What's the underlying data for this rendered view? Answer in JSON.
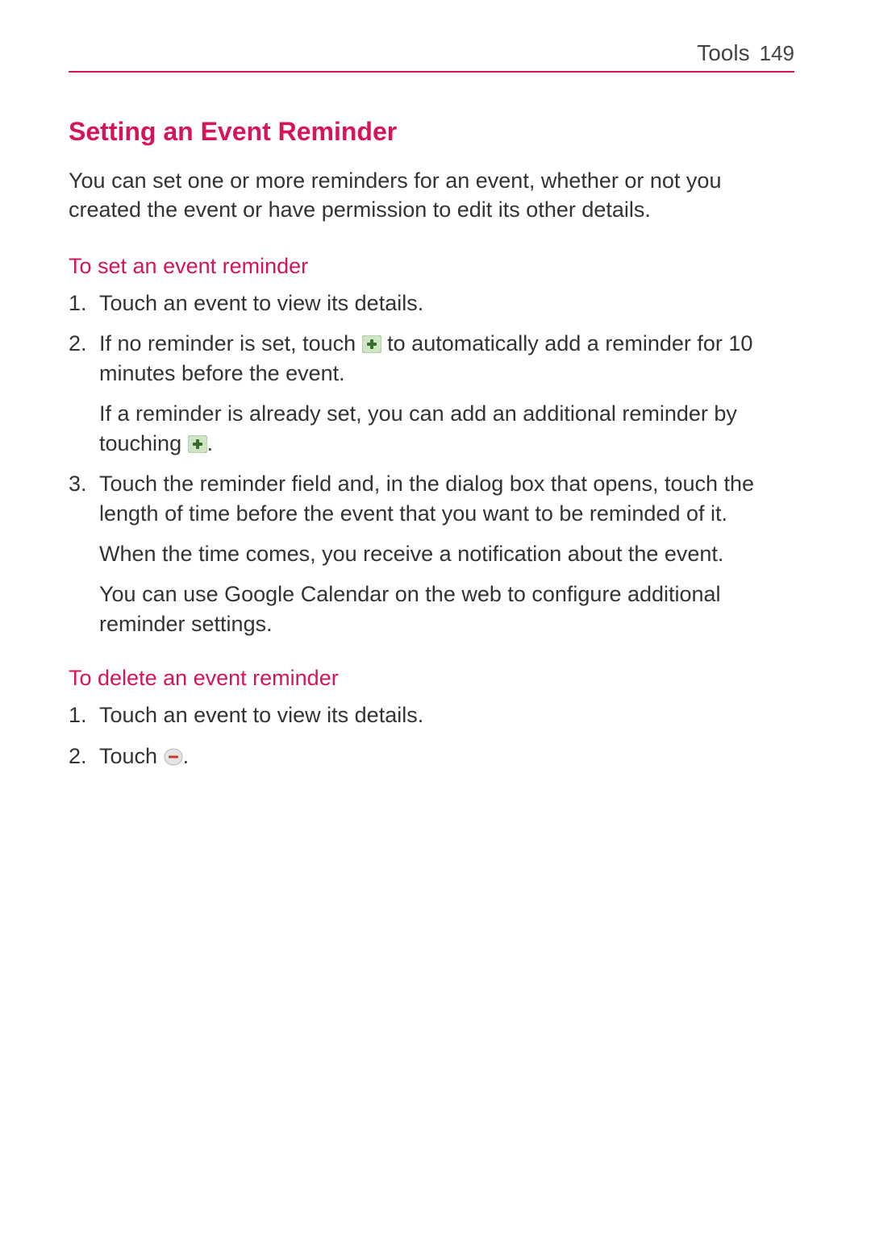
{
  "header": {
    "section": "Tools",
    "page": "149"
  },
  "mainHeading": "Setting an Event Reminder",
  "intro": "You can set one or more reminders for an event, whether or not you created the event or have permission to edit its other details.",
  "section1": {
    "heading": "To set an event reminder",
    "items": {
      "n1": "1.",
      "t1": "Touch an event to view its details.",
      "n2": "2.",
      "t2a": "If no reminder is set, touch ",
      "t2b": " to automatically add a reminder for 10 minutes before the event.",
      "t2c": "If a reminder is already set, you can add an additional reminder by touching ",
      "t2d": ".",
      "n3": "3.",
      "t3a": "Touch the reminder field and, in the dialog box that opens, touch the length of time before the event that you want to be reminded of it.",
      "t3b": "When the time comes, you receive a notification about the event.",
      "t3c": "You can use Google Calendar on the web to configure additional reminder settings."
    }
  },
  "section2": {
    "heading": "To delete an event reminder",
    "items": {
      "n1": "1.",
      "t1": "Touch an event to view its details.",
      "n2": "2.",
      "t2a": "Touch ",
      "t2b": "."
    }
  }
}
